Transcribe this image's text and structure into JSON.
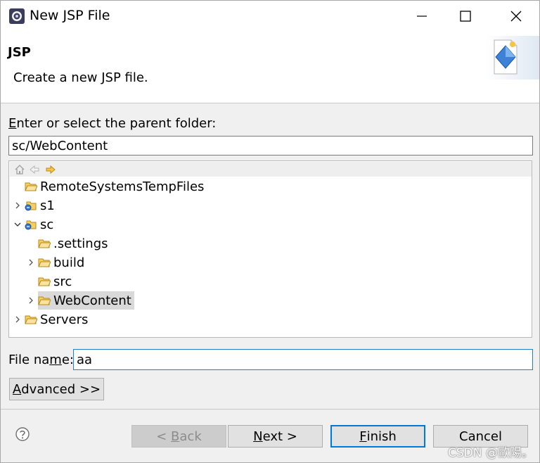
{
  "window": {
    "title": "New JSP File"
  },
  "header": {
    "title": "JSP",
    "description": "Create a new JSP file."
  },
  "parent_folder": {
    "label_mnemonic": "E",
    "label_rest": "nter or select the parent folder:",
    "value": "sc/WebContent"
  },
  "tree": {
    "items": [
      {
        "label": "RemoteSystemsTempFiles",
        "type": "folder",
        "expandable": false,
        "expanded": false,
        "level": 0
      },
      {
        "label": "s1",
        "type": "project",
        "expandable": true,
        "expanded": false,
        "level": 0
      },
      {
        "label": "sc",
        "type": "project",
        "expandable": true,
        "expanded": true,
        "level": 0
      },
      {
        "label": ".settings",
        "type": "folder",
        "expandable": false,
        "expanded": false,
        "level": 1
      },
      {
        "label": "build",
        "type": "folder",
        "expandable": true,
        "expanded": false,
        "level": 1
      },
      {
        "label": "src",
        "type": "folder",
        "expandable": false,
        "expanded": false,
        "level": 1
      },
      {
        "label": "WebContent",
        "type": "folder",
        "expandable": true,
        "expanded": false,
        "level": 1,
        "selected": true
      },
      {
        "label": "Servers",
        "type": "folder",
        "expandable": true,
        "expanded": false,
        "level": 0
      }
    ]
  },
  "file_name": {
    "label_pre": "File na",
    "label_mnemonic": "m",
    "label_post": "e:",
    "value": "aa"
  },
  "buttons": {
    "advanced_mnemonic": "A",
    "advanced_rest": "dvanced >>",
    "back_pre": "< ",
    "back_mnemonic": "B",
    "back_rest": "ack",
    "next_mnemonic": "N",
    "next_rest": "ext >",
    "finish_mnemonic": "F",
    "finish_rest": "inish",
    "cancel": "Cancel"
  },
  "watermark": "CSDN @歐陽。",
  "colors": {
    "accent": "#0078d7",
    "selection": "#d9d9d9",
    "folder": "#e8b23a"
  }
}
